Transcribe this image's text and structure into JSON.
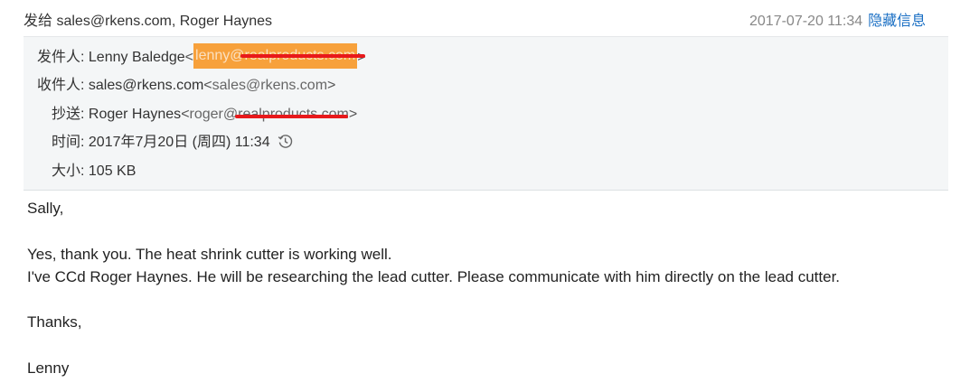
{
  "topbar": {
    "sent_prefix": "发给",
    "sent_to": "sales@rkens.com, Roger Haynes",
    "date": "2017-07-20 11:34",
    "hide_link": "隐藏信息"
  },
  "header": {
    "from_label": "发件人:",
    "from_name": "Lenny Baledge",
    "from_email": "lenny@realproducts.com",
    "to_label": "收件人:",
    "to_name": "sales@rkens.com",
    "to_email": "sales@rkens.com",
    "cc_label": "抄送:",
    "cc_name": "Roger Haynes",
    "cc_email": "roger@realproducts.com",
    "time_label": "时间:",
    "time_value": "2017年7月20日 (周四) 11:34",
    "size_label": "大小:",
    "size_value": "105 KB",
    "icons": {
      "time": "clock-history-icon"
    },
    "colors": {
      "redact_orange": "#f7a13b",
      "redact_red": "#e8191b",
      "link_blue": "#1a6fc4"
    }
  },
  "body": {
    "greeting": "Sally,",
    "line1": "Yes, thank you. The heat shrink cutter is working well.",
    "line2": "I've CCd Roger Haynes. He will be researching the lead cutter. Please communicate with him directly on the lead cutter.",
    "closing": "Thanks,",
    "signature": "Lenny"
  }
}
